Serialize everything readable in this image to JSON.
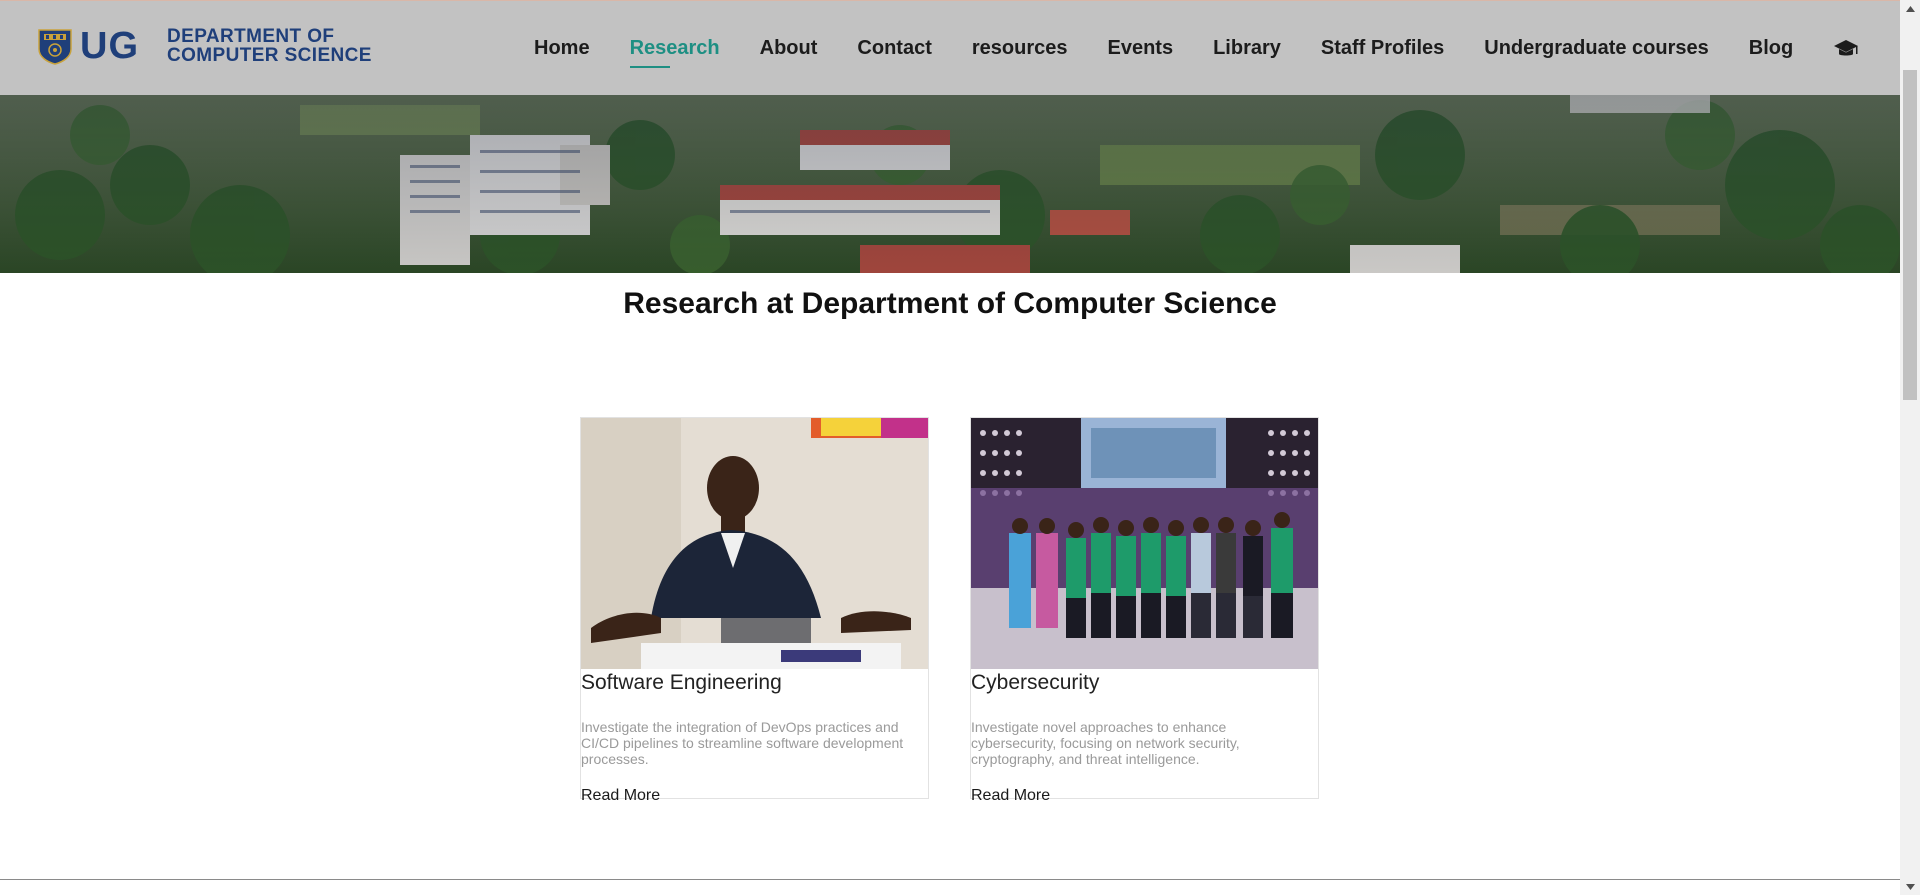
{
  "brand": {
    "mark": "UG",
    "line1": "DEPARTMENT OF",
    "line2": "COMPUTER SCIENCE"
  },
  "nav": {
    "items": [
      {
        "label": "Home"
      },
      {
        "label": "Research"
      },
      {
        "label": "About"
      },
      {
        "label": "Contact"
      },
      {
        "label": "resources"
      },
      {
        "label": "Events"
      },
      {
        "label": "Library"
      },
      {
        "label": "Staff Profiles"
      },
      {
        "label": "Undergraduate courses"
      },
      {
        "label": "Blog"
      }
    ],
    "active": "Research",
    "end_icon": "graduation-cap-icon"
  },
  "page": {
    "title": "Research at Department of Computer Science"
  },
  "cards": [
    {
      "title": "Software Engineering",
      "description": "Investigate the integration of DevOps practices and CI/CD pipelines to streamline software development processes.",
      "link": "Read More"
    },
    {
      "title": "Cybersecurity",
      "description": "Investigate novel approaches to enhance cybersecurity, focusing on network security, cryptography, and threat intelligence.",
      "link": "Read More"
    }
  ],
  "colors": {
    "header_bg": "#c2c2c2",
    "brand_blue": "#1f3f7a",
    "active_nav": "#1e8f83",
    "muted_text": "#9a9a9a"
  }
}
